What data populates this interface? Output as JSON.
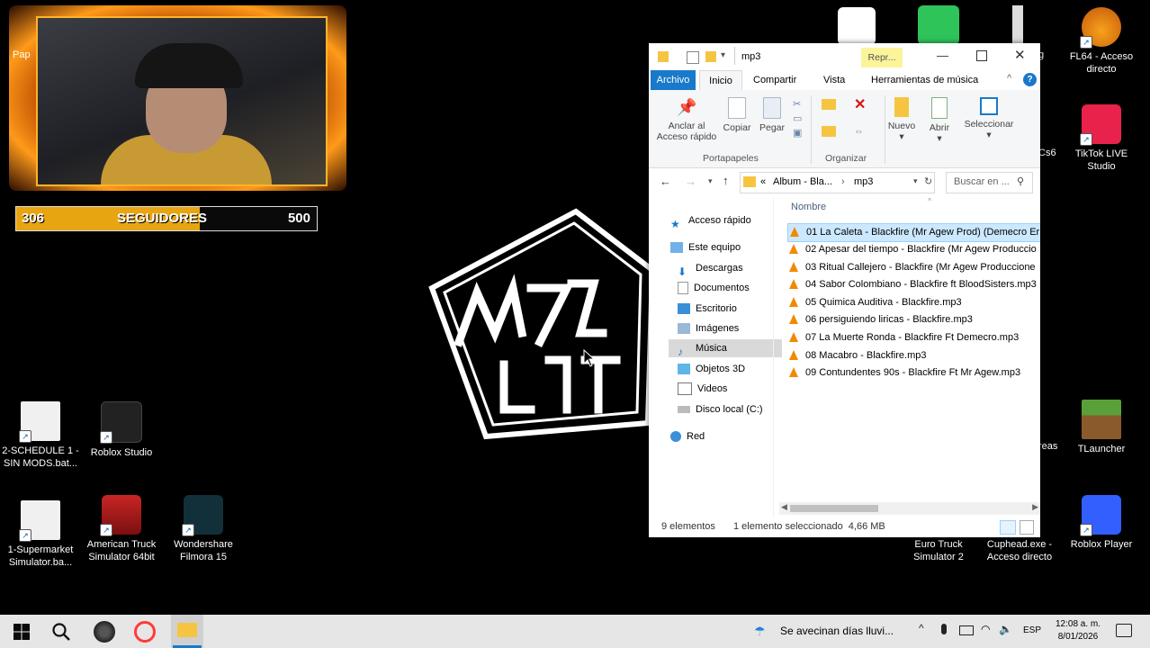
{
  "overlay": {
    "followers_current": "306",
    "followers_label": "SEGUIDORES",
    "followers_goal": "500",
    "progress_fraction": 0.61
  },
  "desktop_icons": {
    "left_partial": "Pap",
    "fl64": "FL64 - Acceso directo",
    "tiktok": "TikTok LIVE Studio",
    "tlauncher": "TLauncher",
    "roblox_player": "Roblox Player",
    "cuphead": "Cuphead.exe - Acceso directo",
    "euro_truck": "Euro Truck Simulator 2",
    "schedule": "2-SCHEDULE 1 - SIN MODS.bat...",
    "roblox_studio": "Roblox Studio",
    "supermarket": "1-Supermarket Simulator.ba...",
    "american_truck": "American Truck Simulator 64bit",
    "filmora": "Wondershare Filmora 15",
    "partial_cs6": "Cs6",
    "partial_reas": "reas",
    "partial_g": "g"
  },
  "explorer": {
    "title": "mp3",
    "context_tab": "Repr...",
    "tabs": [
      "Archivo",
      "Inicio",
      "Compartir",
      "Vista",
      "Herramientas de música"
    ],
    "ribbon": {
      "pin": "Anclar al Acceso rápido",
      "copy": "Copiar",
      "paste": "Pegar",
      "group_clipboard": "Portapapeles",
      "group_organize": "Organizar",
      "new": "Nuevo",
      "open": "Abrir",
      "select": "Seleccionar"
    },
    "address": {
      "prefix": "«",
      "crumb1": "Album - Bla...",
      "crumb2": "mp3",
      "search_placeholder": "Buscar en ..."
    },
    "nav": {
      "quick_access": "Acceso rápido",
      "this_pc": "Este equipo",
      "downloads": "Descargas",
      "documents": "Documentos",
      "desktop": "Escritorio",
      "images": "Imágenes",
      "music": "Música",
      "objects3d": "Objetos 3D",
      "videos": "Videos",
      "local_disk": "Disco local (C:)",
      "network": "Red"
    },
    "column_header": "Nombre",
    "files": [
      "01 La Caleta - Blackfire (Mr Agew Prod) (Demecro Er",
      "02 Apesar del tiempo - Blackfire (Mr Agew Produccio",
      "03 Ritual Callejero - Blackfire (Mr Agew Produccione",
      "04 Sabor Colombiano - Blackfire ft BloodSisters.mp3",
      "05 Quimica Auditiva - Blackfire.mp3",
      "06 persiguiendo liricas - Blackfire.mp3",
      "07 La Muerte Ronda - Blackfire Ft Demecro.mp3",
      "08 Macabro - Blackfire.mp3",
      "09 Contundentes 90s - Blackfire Ft Mr Agew.mp3"
    ],
    "status": {
      "count": "9 elementos",
      "selection": "1 elemento seleccionado  4,66 MB"
    }
  },
  "taskbar": {
    "weather": "Se avecinan días lluvi...",
    "language": "ESP",
    "time": "12:08 a. m.",
    "date": "8/01/2026"
  },
  "colors": {
    "ribbon_file_tab": "#1979ca",
    "selection": "#cce8ff",
    "nav_selected": "#d9d9d9",
    "vlc_orange": "#f08a00",
    "follower_fill": "#e8a512"
  }
}
